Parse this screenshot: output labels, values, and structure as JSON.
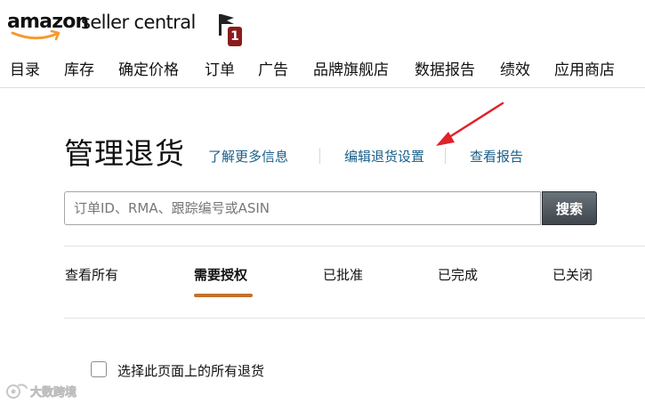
{
  "header": {
    "logo_brand": "amazon",
    "logo_product": "seller central",
    "notification_count": "1",
    "notification_icon": "flag-icon"
  },
  "nav": {
    "items": [
      {
        "label": "目录"
      },
      {
        "label": "库存"
      },
      {
        "label": "确定价格"
      },
      {
        "label": "订单"
      },
      {
        "label": "广告"
      },
      {
        "label": "品牌旗舰店"
      },
      {
        "label": "数据报告"
      },
      {
        "label": "绩效"
      },
      {
        "label": "应用商店"
      }
    ]
  },
  "page": {
    "title": "管理退货",
    "links": {
      "learn_more": "了解更多信息",
      "edit_settings": "编辑退货设置",
      "view_report": "查看报告"
    }
  },
  "search": {
    "value": "",
    "placeholder": "订单ID、RMA、跟踪编号或ASIN",
    "button_label": "搜索"
  },
  "tabs": [
    {
      "label": "查看所有",
      "active": false
    },
    {
      "label": "需要授权",
      "active": true
    },
    {
      "label": "已批准",
      "active": false
    },
    {
      "label": "已完成",
      "active": false
    },
    {
      "label": "已关闭",
      "active": false
    }
  ],
  "select_all": {
    "label": "选择此页面上的所有退货",
    "checked": false
  },
  "watermark": {
    "text": "大数跨境"
  },
  "colors": {
    "link": "#1a5f8a",
    "active_tab_underline": "#c4712c",
    "badge": "#8c1b1b",
    "annotation_arrow": "#e0222a",
    "logo_smile": "#f59a2e"
  }
}
